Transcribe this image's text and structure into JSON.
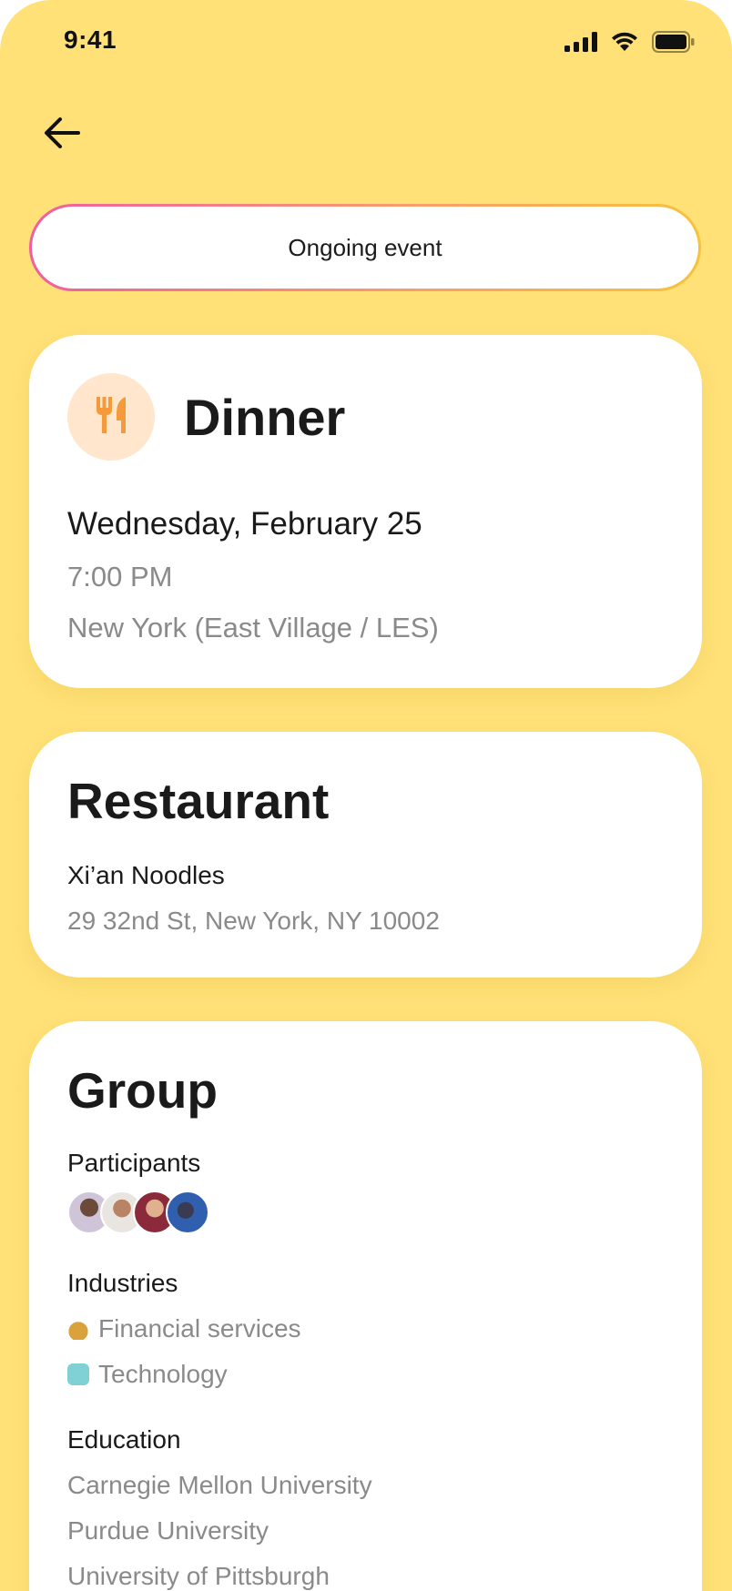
{
  "status_bar": {
    "time": "9:41"
  },
  "ongoing_label": "Ongoing event",
  "dinner": {
    "title": "Dinner",
    "date": "Wednesday, February 25",
    "time": "7:00 PM",
    "location": "New York (East Village / LES)"
  },
  "restaurant": {
    "title": "Restaurant",
    "name": "Xi’an Noodles",
    "address": "29 32nd St, New York, NY 10002"
  },
  "group": {
    "title": "Group",
    "participants_label": "Participants",
    "industries_label": "Industries",
    "industries": [
      {
        "emoji": "💰",
        "label": "Financial services"
      },
      {
        "emoji": "🤖",
        "label": "Technology"
      }
    ],
    "education_label": "Education",
    "education": [
      "Carnegie Mellon University",
      "Purdue University",
      "University of Pittsburgh"
    ]
  },
  "colors": {
    "background": "#FFE177",
    "card": "#FFFFFF",
    "accent_orange": "#F59A3B",
    "gradient": [
      "#EE5FA0",
      "#F8C23A"
    ]
  },
  "icons": {
    "back": "arrow-left-icon",
    "dinner": "fork-knife-icon"
  }
}
